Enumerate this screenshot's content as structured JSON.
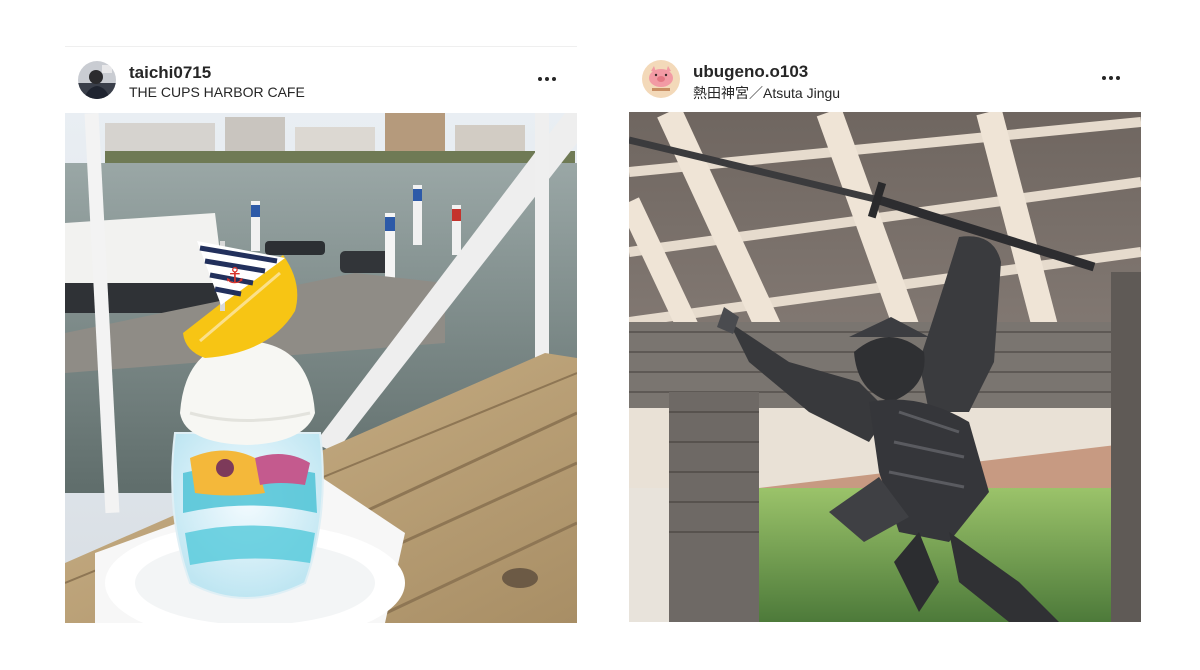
{
  "posts": [
    {
      "username": "taichi0715",
      "location": "THE CUPS HARBOR CAFE",
      "avatar_icon": "user-avatar-icon",
      "more_icon": "more-options-icon",
      "image_description_icon": "parfait-photo"
    },
    {
      "username": "ubugeno.o103",
      "location": "熱田神宮／Atsuta Jingu",
      "avatar_icon": "pig-logo-avatar-icon",
      "more_icon": "more-options-icon",
      "image_description_icon": "samurai-statue-photo"
    }
  ],
  "colors": {
    "text": "#262626",
    "divider": "#efefef",
    "background": "#ffffff"
  }
}
